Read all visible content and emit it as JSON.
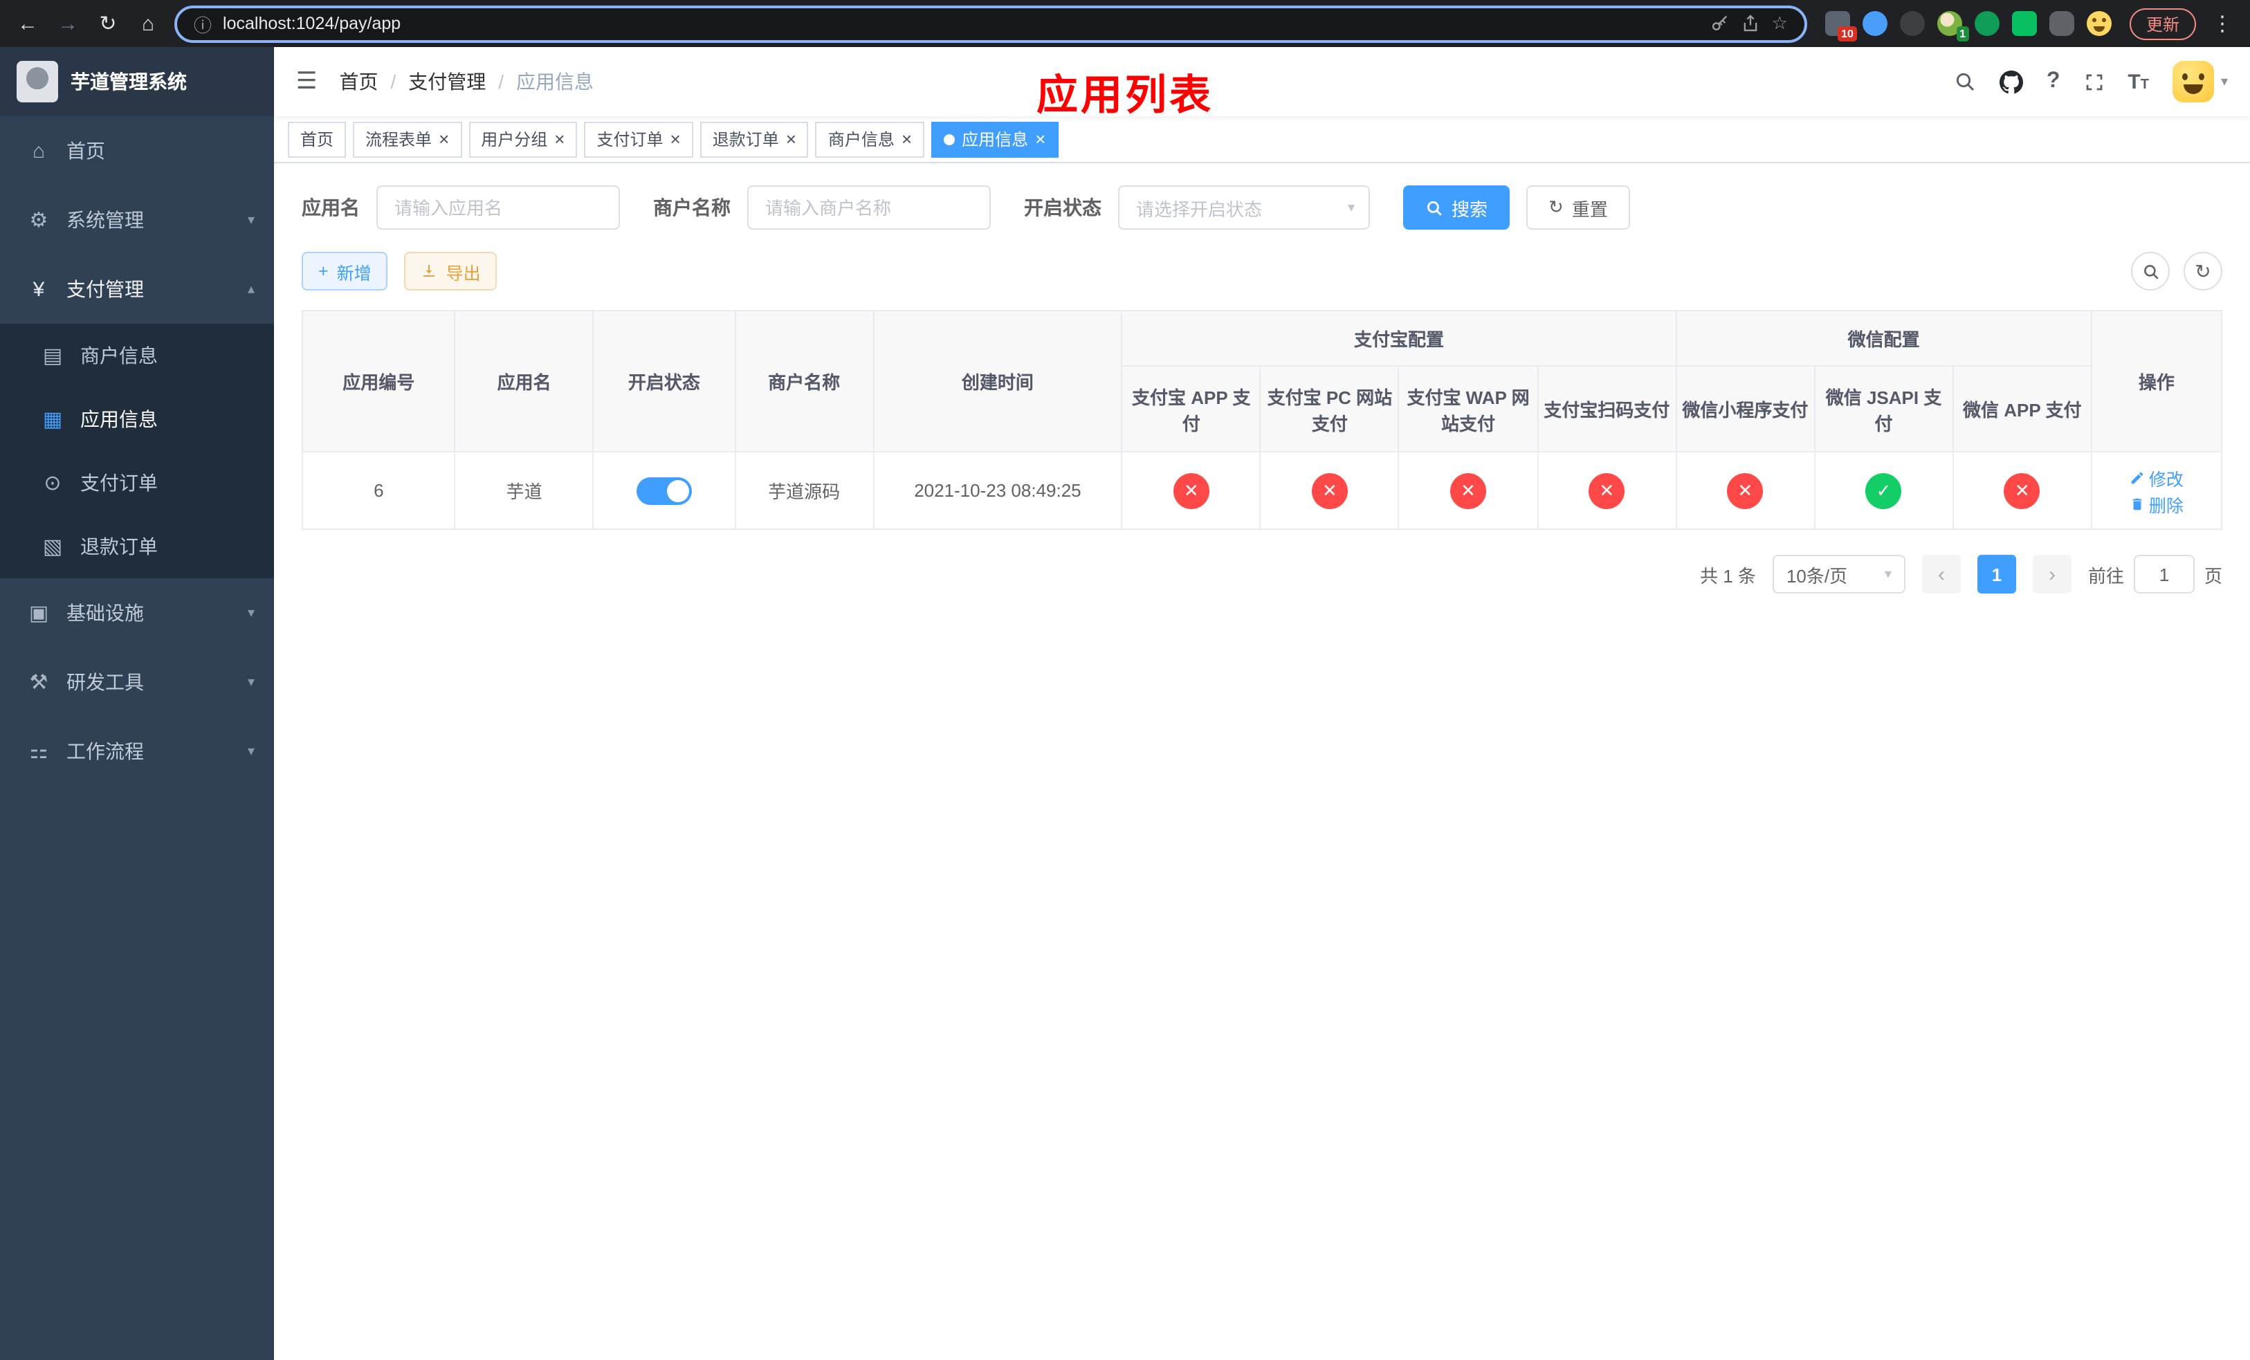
{
  "browser": {
    "url": "localhost:1024/pay/app",
    "update_label": "更新",
    "ext_badge_red": "10",
    "ext_badge_green": "1"
  },
  "icons": {
    "back": "←",
    "forward": "→",
    "reload": "↻",
    "home": "⌂",
    "info": "ⓘ",
    "star": "☆",
    "menu_dots": "⋮",
    "hamburger": "☰",
    "slash": "/",
    "help": "?",
    "caret_down": "▾",
    "chevron_down": "▾",
    "chevron_up": "▴",
    "font_large": "T",
    "font_small": "T",
    "close": "×",
    "plus": "+",
    "refresh": "↻",
    "check": "✓",
    "cross": "✕",
    "prev": "‹",
    "next": "›",
    "select_arrow": "▾"
  },
  "sidebar": {
    "logo_title": "芋道管理系统",
    "items": [
      {
        "label": "首页",
        "glyph": "⌂"
      },
      {
        "label": "系统管理",
        "glyph": "⚙"
      },
      {
        "label": "支付管理",
        "glyph": "¥"
      },
      {
        "label": "基础设施",
        "glyph": "▣"
      },
      {
        "label": "研发工具",
        "glyph": "⚒"
      },
      {
        "label": "工作流程",
        "glyph": "⚏"
      }
    ],
    "submenu": [
      {
        "label": "商户信息",
        "glyph": "▤"
      },
      {
        "label": "应用信息",
        "glyph": "▦"
      },
      {
        "label": "支付订单",
        "glyph": "⊙"
      },
      {
        "label": "退款订单",
        "glyph": "▧"
      }
    ]
  },
  "header": {
    "breadcrumb": [
      "首页",
      "支付管理",
      "应用信息"
    ],
    "overlay_title": "应用列表"
  },
  "tabs": [
    {
      "label": "首页"
    },
    {
      "label": "流程表单"
    },
    {
      "label": "用户分组"
    },
    {
      "label": "支付订单"
    },
    {
      "label": "退款订单"
    },
    {
      "label": "商户信息"
    },
    {
      "label": "应用信息"
    }
  ],
  "filters": {
    "app_name_label": "应用名",
    "app_name_placeholder": "请输入应用名",
    "merchant_label": "商户名称",
    "merchant_placeholder": "请输入商户名称",
    "status_label": "开启状态",
    "status_placeholder": "请选择开启状态",
    "search_label": "搜索",
    "reset_label": "重置"
  },
  "toolbar": {
    "add_label": "新增",
    "export_label": "导出"
  },
  "table": {
    "group_alipay": "支付宝配置",
    "group_wechat": "微信配置",
    "columns": [
      "应用编号",
      "应用名",
      "开启状态",
      "商户名称",
      "创建时间",
      "支付宝 APP 支付",
      "支付宝 PC 网站支付",
      "支付宝 WAP 网站支付",
      "支付宝扫码支付",
      "微信小程序支付",
      "微信 JSAPI 支付",
      "微信 APP 支付",
      "操作"
    ],
    "rows": [
      {
        "id": "6",
        "name": "芋道",
        "status_on": true,
        "merchant": "芋道源码",
        "created": "2021-10-23 08:49:25",
        "channels": [
          "no",
          "no",
          "no",
          "no",
          "no",
          "yes",
          "no"
        ],
        "edit_label": "修改",
        "delete_label": "删除"
      }
    ]
  },
  "pagination": {
    "total": "共 1 条",
    "page_size": "10条/页",
    "current_page": "1",
    "goto_label": "前往",
    "goto_value": "1",
    "page_suffix": "页"
  }
}
